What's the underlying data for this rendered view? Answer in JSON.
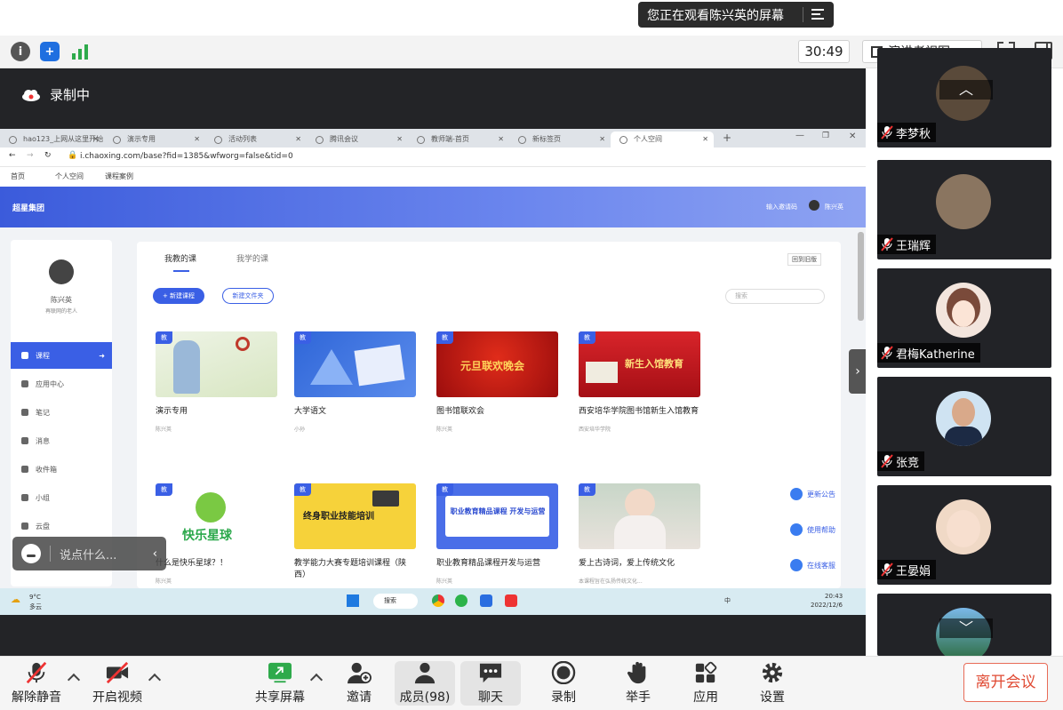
{
  "banner": {
    "text": "您正在观看陈兴英的屏幕"
  },
  "toolbar": {
    "timer": "30:49",
    "view": "演讲者视图"
  },
  "recording": {
    "label": "录制中"
  },
  "browser": {
    "tabs": [
      "hao123_上网从这里开始",
      "演示专用",
      "活动列表",
      "腾讯会议",
      "教师端-首页",
      "新标签页",
      "个人空间"
    ],
    "url": "i.chaoxing.com/base?fid=1385&wfworg=false&tid=0",
    "bookmarks": [
      "首页",
      "个人空间",
      "课程案例"
    ]
  },
  "site": {
    "brand": "超星集团",
    "invite": "输入邀请码",
    "user": "陈兴英",
    "profile_name": "陈兴英",
    "profile_sub": "再联网的老人",
    "nav": [
      "课程",
      "应用中心",
      "笔记",
      "消息",
      "收件箱",
      "小组",
      "云盘"
    ],
    "tabs": [
      "我教的课",
      "我学的课"
    ],
    "back_old": "回到旧版",
    "new_course": "+ 新建课程",
    "new_folder": "新建文件夹",
    "search_placeholder": "搜索",
    "tag": "教",
    "courses": [
      {
        "title": "演示专用",
        "teacher": "陈兴英"
      },
      {
        "title": "大学语文",
        "teacher": "小孙"
      },
      {
        "title": "图书馆联欢会",
        "teacher": "陈兴英",
        "thumb_text": "元旦联欢晚会"
      },
      {
        "title": "西安培华学院图书馆新生入馆教育",
        "teacher": "西安培华学院",
        "thumb_text": "新生入馆教育"
      },
      {
        "title": "什么是快乐星球？！",
        "teacher": "陈兴英",
        "thumb_text": "快乐星球"
      },
      {
        "title": "教学能力大赛专题培训课程（陕西）",
        "teacher": "",
        "thumb_text": "终身职业技能培训"
      },
      {
        "title": "职业教育精品课程开发与运营",
        "teacher": "陈兴英",
        "thumb_text": "职业教育精品课程 开发与运营"
      },
      {
        "title": "爱上古诗词，爱上传统文化",
        "teacher": "本课程旨在弘扬传统文化..."
      }
    ],
    "helpers": [
      "更新公告",
      "使用帮助",
      "在线客服"
    ]
  },
  "taskbar": {
    "weather": "9°C",
    "weather_sub": "多云",
    "search": "搜索",
    "time": "20:43",
    "date": "2022/12/6",
    "lang": "中"
  },
  "chat": {
    "placeholder": "说点什么..."
  },
  "participants": [
    {
      "name": "李梦秋",
      "color": "#5a4a3a"
    },
    {
      "name": "王瑞辉",
      "color": "#8a7560"
    },
    {
      "name": "君梅Katherine",
      "color": "#f3e5dd"
    },
    {
      "name": "张竞",
      "color": "#cfe3f2"
    },
    {
      "name": "王晏娟",
      "color": "#f0d9c6"
    },
    {
      "name": "",
      "color": "#4a8fc8"
    }
  ],
  "controls": {
    "mute": "解除静音",
    "video": "开启视频",
    "share": "共享屏幕",
    "invite": "邀请",
    "members": "成员(98)",
    "chat": "聊天",
    "record": "录制",
    "hand": "举手",
    "apps": "应用",
    "settings": "设置",
    "leave": "离开会议"
  }
}
